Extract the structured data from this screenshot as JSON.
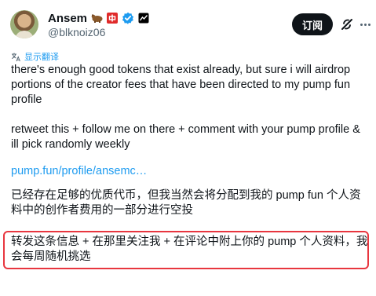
{
  "author": {
    "name": "Ansem",
    "handle": "@blknoiz06"
  },
  "actions": {
    "subscribe_label": "订阅"
  },
  "translate": {
    "label": "显示翻译"
  },
  "tweet": {
    "paragraph1": "there's enough good tokens that exist already, but sure i will airdrop portions of the creator fees that have been directed to my pump fun profile",
    "paragraph2": "retweet this + follow me on there + comment with your pump profile & ill pick randomly weekly",
    "link": "pump.fun/profile/ansemc…"
  },
  "translation": {
    "paragraph1": "已经存在足够的优质代币，但我当然会将分配到我的 pump fun 个人资料中的创作者费用的一部分进行空投",
    "paragraph2": "转发这条信息 + 在那里关注我 + 在评论中附上你的 pump 个人资料，我会每周随机挑选"
  },
  "colors": {
    "link": "#1d9bf0",
    "verified": "#1d9bf0",
    "highlight_border": "#e8363f",
    "subscribe_bg": "#0f1419"
  },
  "icons": [
    "avatar",
    "bear-emoji-icon",
    "china-flag-badge-icon",
    "verified-badge-icon",
    "affiliate-badge-icon",
    "grok-icon",
    "more-icon",
    "translate-icon"
  ]
}
